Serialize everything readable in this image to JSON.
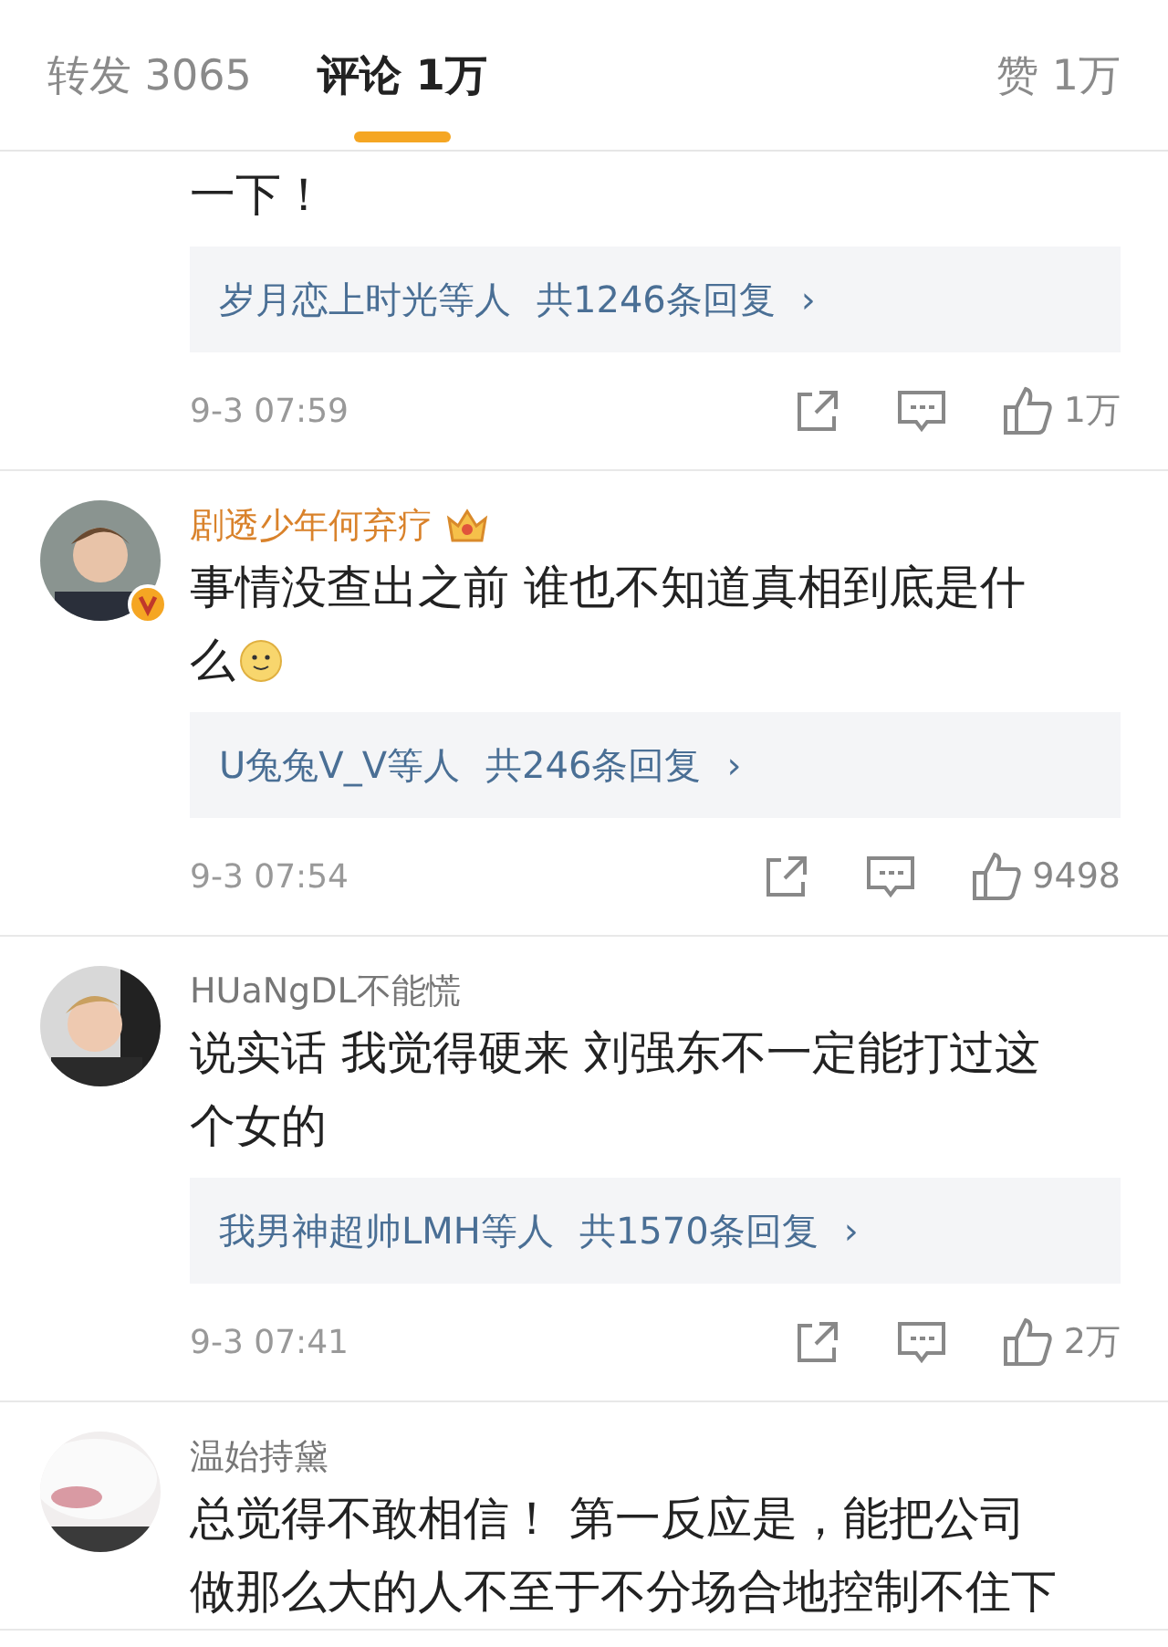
{
  "tabs": [
    {
      "label": "转发 3065",
      "selected": false
    },
    {
      "label": "评论 1万",
      "selected": true
    }
  ],
  "likes_tab": "赞 1万",
  "comments": [
    {
      "text_lines": [
        "一下！"
      ],
      "replies": {
        "names": "岁月恋上时光等人",
        "count": "共1246条回复",
        "chevron": "›"
      },
      "time": "9-3 07:59",
      "likes": "1万"
    },
    {
      "name": "剧透少年何弃疗",
      "member": true,
      "verified": true,
      "text_lines": [
        "事情没查出之前 谁也不知道真相到底是什",
        "么"
      ],
      "emoji": true,
      "replies": {
        "names": "U兔兔V_V等人",
        "count": "共246条回复",
        "chevron": "›"
      },
      "time": "9-3 07:54",
      "likes": "9498"
    },
    {
      "name": "HUaNgDL不能慌",
      "member": false,
      "text_lines": [
        "说实话 我觉得硬来 刘强东不一定能打过这",
        "个女的"
      ],
      "replies": {
        "names": "我男神超帅LMH等人",
        "count": "共1570条回复",
        "chevron": "›"
      },
      "time": "9-3 07:41",
      "likes": "2万"
    },
    {
      "name": "温始持黛",
      "member": false,
      "text_lines": [
        "总觉得不敢相信！ 第一反应是，能把公司",
        "做那么大的人不至于不分场合地控制不住下"
      ]
    }
  ]
}
